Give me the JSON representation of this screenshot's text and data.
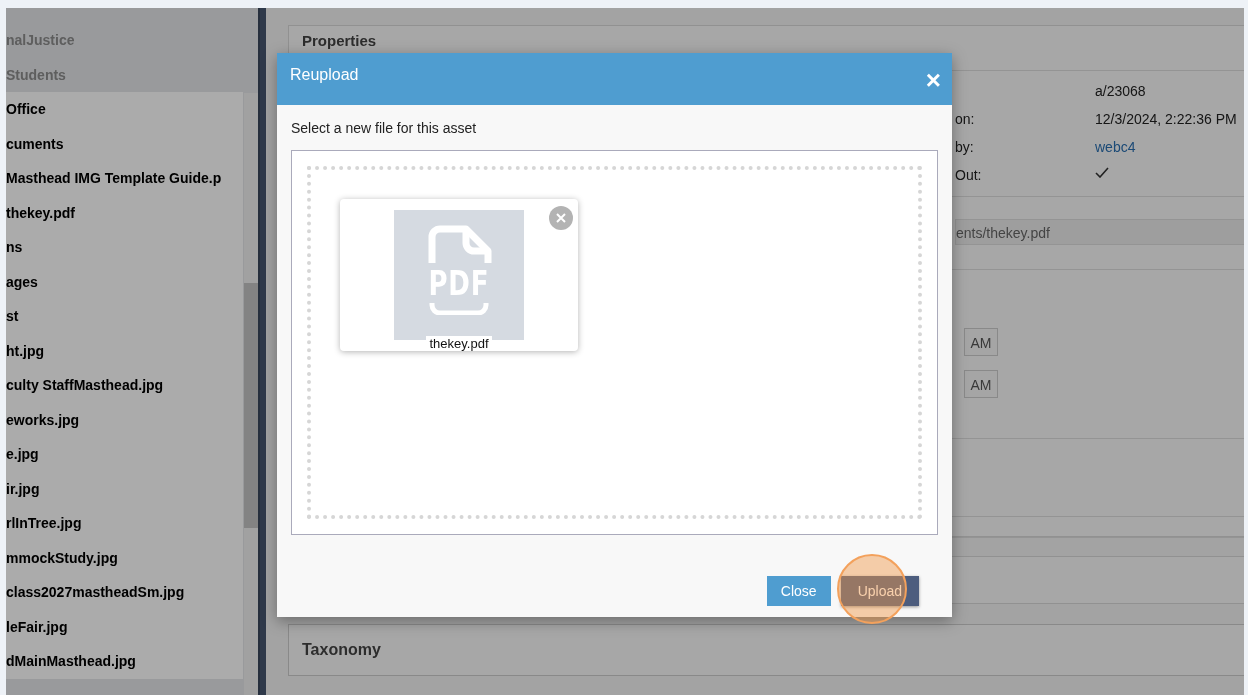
{
  "sidebar": {
    "items": [
      {
        "label": "nalJustice",
        "disabled": true
      },
      {
        "label": "Students",
        "disabled": true
      },
      {
        "label": "Office",
        "disabled": false
      },
      {
        "label": "cuments",
        "disabled": false
      },
      {
        "label": "Masthead IMG Template Guide.p",
        "disabled": false
      },
      {
        "label": "thekey.pdf",
        "disabled": false
      },
      {
        "label": "ns",
        "disabled": false
      },
      {
        "label": "ages",
        "disabled": false
      },
      {
        "label": "st",
        "disabled": false
      },
      {
        "label": "ht.jpg",
        "disabled": false
      },
      {
        "label": "culty StaffMasthead.jpg",
        "disabled": false
      },
      {
        "label": "eworks.jpg",
        "disabled": false
      },
      {
        "label": "e.jpg",
        "disabled": false
      },
      {
        "label": "ir.jpg",
        "disabled": false
      },
      {
        "label": "rlInTree.jpg",
        "disabled": false
      },
      {
        "label": "mmockStudy.jpg",
        "disabled": false
      },
      {
        "label": "class2027mastheadSm.jpg",
        "disabled": false
      },
      {
        "label": "leFair.jpg",
        "disabled": false
      },
      {
        "label": "dMainMasthead.jpg",
        "disabled": false
      }
    ]
  },
  "properties": {
    "title": "Properties",
    "rows": [
      {
        "label": "",
        "value": "a/23068",
        "kind": "text"
      },
      {
        "label": "on:",
        "value": "12/3/2024, 2:22:36 PM",
        "kind": "text"
      },
      {
        "label": "by:",
        "value": "webc4",
        "kind": "link"
      },
      {
        "label": "Out:",
        "checked": true,
        "kind": "check"
      }
    ],
    "path": "ents/thekey.pdf",
    "time_suffixes": [
      "AM",
      "AM"
    ]
  },
  "taxonomy": {
    "title": "Taxonomy"
  },
  "dialog": {
    "title": "Reupload",
    "close": "×",
    "prompt": "Select a new file for this asset",
    "files": [
      {
        "name": "thekey.pdf",
        "type": "PDF"
      }
    ],
    "buttons": [
      {
        "label": "Close",
        "kind": "secondary"
      },
      {
        "label": "Upload",
        "kind": "primary",
        "highlighted": true
      }
    ]
  }
}
